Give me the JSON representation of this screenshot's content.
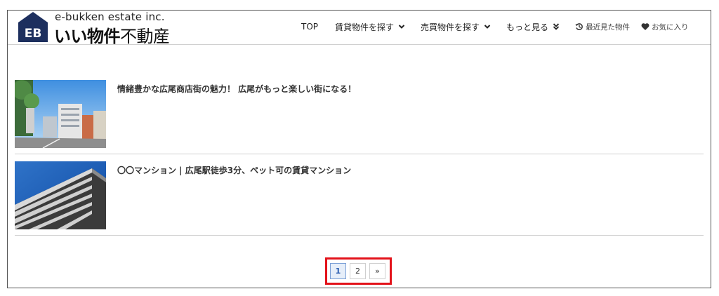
{
  "logo": {
    "mark_text": "EB",
    "company": "e-bukken estate inc.",
    "name_bold": "いい物件",
    "name_regular": "不動産"
  },
  "nav": {
    "top": "TOP",
    "rent": "賃貸物件を探す",
    "sale": "売買物件を探す",
    "more": "もっと見る",
    "recent": "最近見た物件",
    "favorites": "お気に入り"
  },
  "articles": [
    {
      "title": "情緒豊かな広尾商店街の魅力！ 広尾がもっと楽しい街になる！"
    },
    {
      "title": "〇〇マンション | 広尾駅徒歩3分、ペット可の賃貸マンション"
    }
  ],
  "pagination": {
    "current": "1",
    "next_page": "2",
    "next_label": "»"
  },
  "colors": {
    "brand_navy": "#1d2f5e",
    "highlight_red": "#e3121a",
    "active_page_bg": "#e6eef9"
  }
}
